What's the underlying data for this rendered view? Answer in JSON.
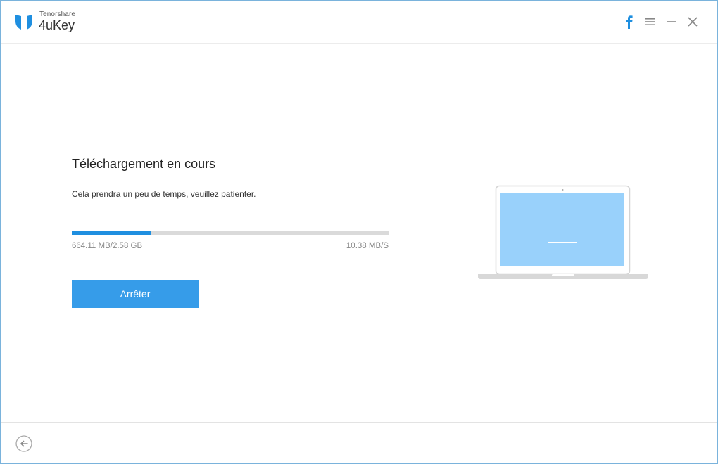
{
  "app": {
    "vendor": "Tenorshare",
    "name": "4uKey",
    "accent_color": "#369ce9"
  },
  "window_controls": {
    "facebook_icon": "facebook-icon",
    "menu_icon": "menu-icon",
    "minimize_icon": "minimize-icon",
    "close_icon": "close-icon"
  },
  "download": {
    "title": "Téléchargement en cours",
    "subtitle": "Cela prendra un peu de temps, veuillez patienter.",
    "progress_fraction": 0.25,
    "size_text": "664.11 MB/2.58 GB",
    "speed_text": "10.38 MB/S",
    "stop_label": "Arrêter"
  },
  "illustration": {
    "name": "laptop-illustration",
    "screen_color": "#99d1fb"
  },
  "footer": {
    "back_icon": "back-arrow-icon"
  }
}
